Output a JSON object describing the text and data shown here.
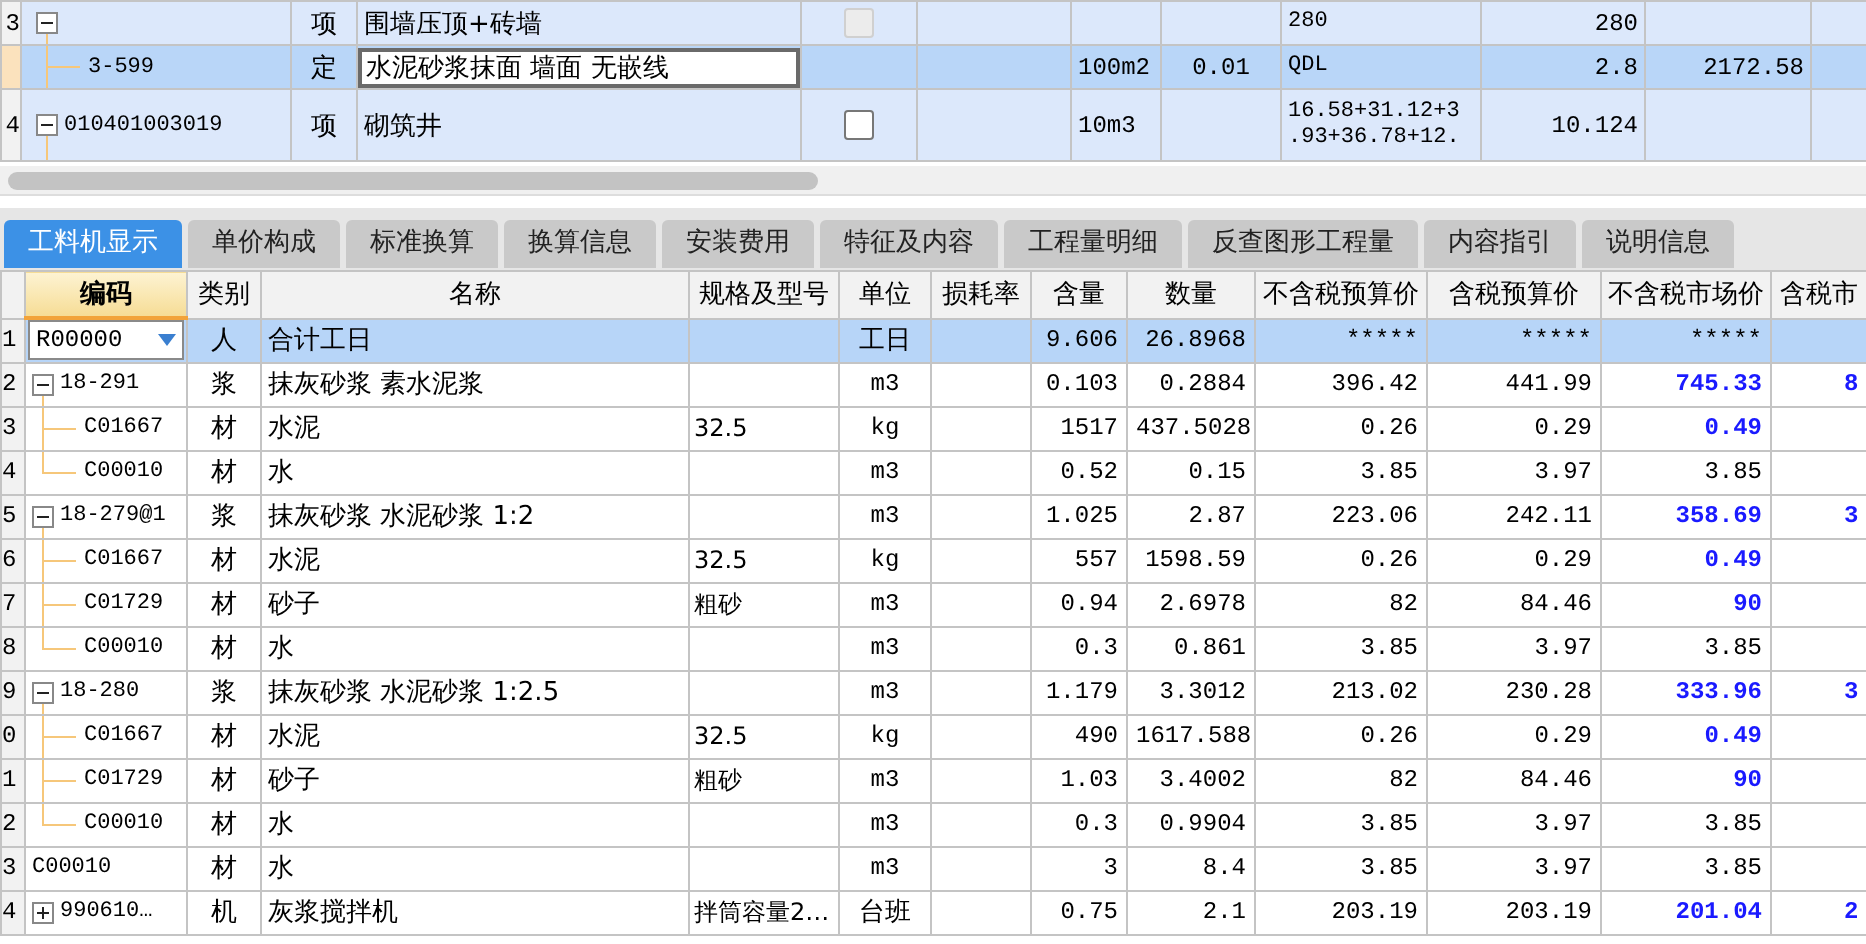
{
  "top_table": {
    "rows": [
      {
        "row_no": "3",
        "kind": "parent",
        "expanded": true,
        "type": "项",
        "name": "围墙压顶+砖墙",
        "checkbox": {
          "checked": false,
          "disabled": true
        },
        "expression": [
          "280"
        ],
        "quantity": "280",
        "selected": false,
        "editing": false
      },
      {
        "kind": "child",
        "code": "3-599",
        "type": "定",
        "name": "水泥砂浆抹面 墙面 无嵌线",
        "unit": "100m2",
        "column_8": "0.01",
        "expression": [
          "QDL"
        ],
        "quantity": "2.8",
        "amount": "2172.58",
        "selected": true,
        "editing": true
      },
      {
        "row_no": "4",
        "kind": "parent",
        "expanded": true,
        "code": "010401003019",
        "type": "项",
        "name": "砌筑井",
        "checkbox": {
          "checked": false,
          "disabled": false
        },
        "unit": "10m3",
        "expression": [
          "16.58+31.12+3",
          ".93+36.78+12."
        ],
        "quantity": "10.124",
        "selected": false,
        "editing": false
      }
    ]
  },
  "tabs": [
    {
      "label": "工料机显示",
      "selected": true
    },
    {
      "label": "单价构成",
      "selected": false
    },
    {
      "label": "标准换算",
      "selected": false
    },
    {
      "label": "换算信息",
      "selected": false
    },
    {
      "label": "安装费用",
      "selected": false
    },
    {
      "label": "特征及内容",
      "selected": false
    },
    {
      "label": "工程量明细",
      "selected": false
    },
    {
      "label": "反查图形工程量",
      "selected": false
    },
    {
      "label": "内容指引",
      "selected": false
    },
    {
      "label": "说明信息",
      "selected": false
    }
  ],
  "table": {
    "columns": [
      {
        "label": "编码",
        "selected": true
      },
      {
        "label": "类别",
        "selected": false
      },
      {
        "label": "名称",
        "selected": false
      },
      {
        "label": "规格及型号",
        "selected": false
      },
      {
        "label": "单位",
        "selected": false
      },
      {
        "label": "损耗率",
        "selected": false
      },
      {
        "label": "含量",
        "selected": false
      },
      {
        "label": "数量",
        "selected": false
      },
      {
        "label": "不含税预算价",
        "selected": false
      },
      {
        "label": "含税预算价",
        "selected": false
      },
      {
        "label": "不含税市场价",
        "selected": false
      },
      {
        "label": "含税市",
        "selected": false
      }
    ],
    "rows": [
      {
        "row_no": "1",
        "kind": "plain",
        "code": "R00000",
        "category": "人",
        "name": "合计工日",
        "unit": "工日",
        "content": "9.606",
        "quantity": "26.8968",
        "budget_ex_tax": "*****",
        "budget_in_tax": "*****",
        "market_ex_tax": "*****",
        "highlighted": false,
        "selected": true
      },
      {
        "row_no": "2",
        "kind": "parent",
        "expanded": true,
        "code": "18-291",
        "category": "浆",
        "name": "抹灰砂浆 素水泥浆",
        "unit": "m3",
        "content": "0.103",
        "quantity": "0.2884",
        "budget_ex_tax": "396.42",
        "budget_in_tax": "441.99",
        "market_ex_tax": "745.33",
        "highlighted": true,
        "market_in_tax": "8",
        "selected": false
      },
      {
        "row_no": "3",
        "kind": "child",
        "last": false,
        "code": "C01667",
        "category": "材",
        "name": "水泥",
        "spec": "32.5",
        "unit": "kg",
        "content": "1517",
        "quantity": "437.5028",
        "budget_ex_tax": "0.26",
        "budget_in_tax": "0.29",
        "market_ex_tax": "0.49",
        "highlighted": true,
        "selected": false
      },
      {
        "row_no": "4",
        "kind": "child",
        "last": true,
        "code": "C00010",
        "category": "材",
        "name": "水",
        "unit": "m3",
        "content": "0.52",
        "quantity": "0.15",
        "budget_ex_tax": "3.85",
        "budget_in_tax": "3.97",
        "market_ex_tax": "3.85",
        "highlighted": false,
        "selected": false
      },
      {
        "row_no": "5",
        "kind": "parent",
        "expanded": true,
        "code": "18-279@1",
        "category": "浆",
        "name": "抹灰砂浆 水泥砂浆 1:2",
        "unit": "m3",
        "content": "1.025",
        "quantity": "2.87",
        "budget_ex_tax": "223.06",
        "budget_in_tax": "242.11",
        "market_ex_tax": "358.69",
        "highlighted": true,
        "market_in_tax": "3",
        "selected": false
      },
      {
        "row_no": "6",
        "kind": "child",
        "last": false,
        "code": "C01667",
        "category": "材",
        "name": "水泥",
        "spec": "32.5",
        "unit": "kg",
        "content": "557",
        "quantity": "1598.59",
        "budget_ex_tax": "0.26",
        "budget_in_tax": "0.29",
        "market_ex_tax": "0.49",
        "highlighted": true,
        "selected": false
      },
      {
        "row_no": "7",
        "kind": "child",
        "last": false,
        "code": "C01729",
        "category": "材",
        "name": "砂子",
        "spec": "粗砂",
        "unit": "m3",
        "content": "0.94",
        "quantity": "2.6978",
        "budget_ex_tax": "82",
        "budget_in_tax": "84.46",
        "market_ex_tax": "90",
        "highlighted": true,
        "selected": false
      },
      {
        "row_no": "8",
        "kind": "child",
        "last": true,
        "code": "C00010",
        "category": "材",
        "name": "水",
        "unit": "m3",
        "content": "0.3",
        "quantity": "0.861",
        "budget_ex_tax": "3.85",
        "budget_in_tax": "3.97",
        "market_ex_tax": "3.85",
        "highlighted": false,
        "selected": false
      },
      {
        "row_no": "9",
        "kind": "parent",
        "expanded": true,
        "code": "18-280",
        "category": "浆",
        "name": "抹灰砂浆 水泥砂浆 1:2.5",
        "unit": "m3",
        "content": "1.179",
        "quantity": "3.3012",
        "budget_ex_tax": "213.02",
        "budget_in_tax": "230.28",
        "market_ex_tax": "333.96",
        "highlighted": true,
        "market_in_tax": "3",
        "selected": false
      },
      {
        "row_no": "0",
        "kind": "child",
        "last": false,
        "code": "C01667",
        "category": "材",
        "name": "水泥",
        "spec": "32.5",
        "unit": "kg",
        "content": "490",
        "quantity": "1617.588",
        "budget_ex_tax": "0.26",
        "budget_in_tax": "0.29",
        "market_ex_tax": "0.49",
        "highlighted": true,
        "selected": false
      },
      {
        "row_no": "1",
        "kind": "child",
        "last": false,
        "code": "C01729",
        "category": "材",
        "name": "砂子",
        "spec": "粗砂",
        "unit": "m3",
        "content": "1.03",
        "quantity": "3.4002",
        "budget_ex_tax": "82",
        "budget_in_tax": "84.46",
        "market_ex_tax": "90",
        "highlighted": true,
        "selected": false
      },
      {
        "row_no": "2",
        "kind": "child",
        "last": true,
        "code": "C00010",
        "category": "材",
        "name": "水",
        "unit": "m3",
        "content": "0.3",
        "quantity": "0.9904",
        "budget_ex_tax": "3.85",
        "budget_in_tax": "3.97",
        "market_ex_tax": "3.85",
        "highlighted": false,
        "selected": false
      },
      {
        "row_no": "3",
        "kind": "plain",
        "code": "C00010",
        "category": "材",
        "name": "水",
        "unit": "m3",
        "content": "3",
        "quantity": "8.4",
        "budget_ex_tax": "3.85",
        "budget_in_tax": "3.97",
        "market_ex_tax": "3.85",
        "highlighted": false,
        "selected": false
      },
      {
        "row_no": "4",
        "kind": "parent",
        "expanded": false,
        "code": "990610…",
        "category": "机",
        "name": "灰浆搅拌机",
        "spec": "拌筒容量2…",
        "unit": "台班",
        "content": "0.75",
        "quantity": "2.1",
        "budget_ex_tax": "203.19",
        "budget_in_tax": "203.19",
        "market_ex_tax": "201.04",
        "highlighted": true,
        "market_in_tax": "2",
        "selected": false
      }
    ]
  }
}
